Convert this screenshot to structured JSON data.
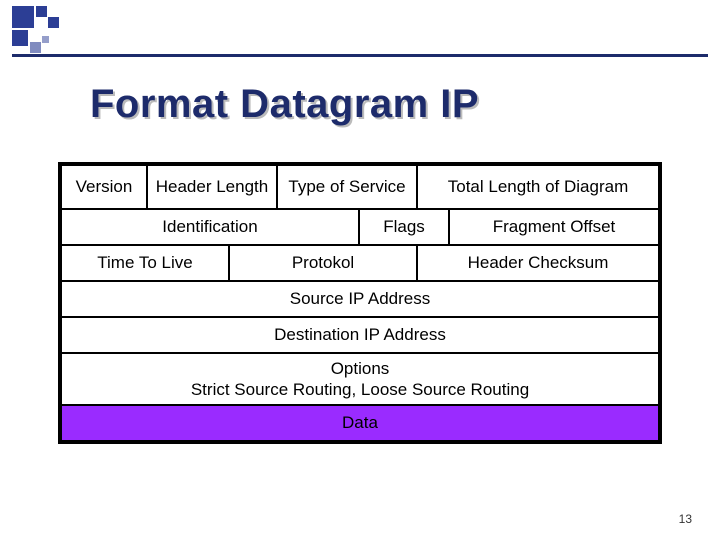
{
  "title": "Format Datagram IP",
  "page_number": "13",
  "datagram": {
    "row1": {
      "version": "Version",
      "header_length": "Header Length",
      "type_of_service": "Type of Service",
      "total_length": "Total Length of Diagram"
    },
    "row2": {
      "identification": "Identification",
      "flags": "Flags",
      "fragment_offset": "Fragment Offset"
    },
    "row3": {
      "ttl": "Time To Live",
      "protocol": "Protokol",
      "checksum": "Header Checksum"
    },
    "source_ip": "Source IP Address",
    "dest_ip": "Destination IP Address",
    "options": "Options\nStrict Source Routing, Loose Source Routing",
    "data": "Data"
  }
}
